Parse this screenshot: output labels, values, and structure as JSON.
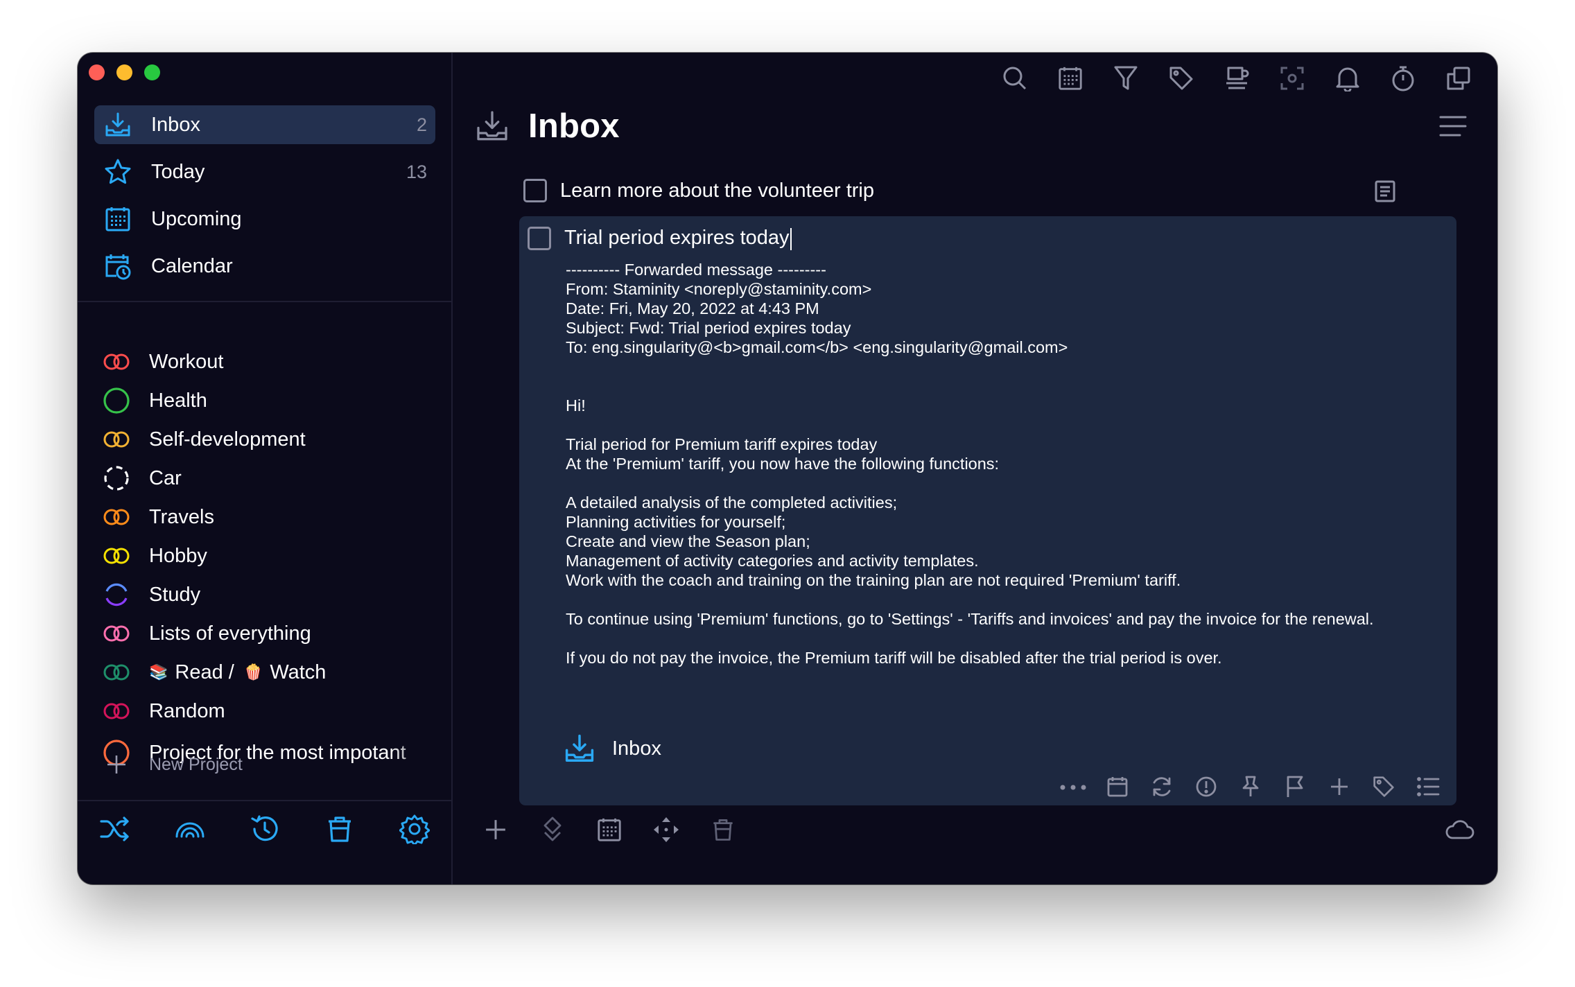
{
  "sidebar": {
    "nav": [
      {
        "label": "Inbox",
        "count": "2",
        "icon": "inbox-tray-icon"
      },
      {
        "label": "Today",
        "count": "13",
        "icon": "star-icon"
      },
      {
        "label": "Upcoming",
        "count": "",
        "icon": "calendar-grid-icon"
      },
      {
        "label": "Calendar",
        "count": "",
        "icon": "calendar-clock-icon"
      }
    ],
    "projects": [
      {
        "label": "Workout",
        "color": "#ff4d4d",
        "icon": "infinity-rings-icon"
      },
      {
        "label": "Health",
        "color": "#36c24a",
        "icon": "ring-icon"
      },
      {
        "label": "Self-development",
        "color": "#f2b233",
        "icon": "infinity-rings-icon"
      },
      {
        "label": "Car",
        "color": "#ffffff",
        "icon": "dashed-ring-icon"
      },
      {
        "label": "Travels",
        "color": "#ff8c1a",
        "icon": "infinity-rings-icon"
      },
      {
        "label": "Hobby",
        "color": "#f5e100",
        "icon": "infinity-rings-icon"
      },
      {
        "label": "Study",
        "color": "#6b5bff",
        "icon": "gradient-ring-icon"
      },
      {
        "label": "Lists of everything",
        "color": "#ff6fae",
        "icon": "infinity-rings-icon"
      },
      {
        "label_a": "Read / ",
        "label_b": "Watch",
        "emoji_a": "📚",
        "emoji_b": "🍿",
        "color": "#1e8f6a",
        "icon": "infinity-rings-icon"
      },
      {
        "label": "Random",
        "color": "#d4145a",
        "icon": "infinity-rings-icon"
      },
      {
        "label": "Project for the most impotant",
        "color": "#ff6a3d",
        "icon": "ring-icon"
      }
    ],
    "new_project": "New Project"
  },
  "main": {
    "title": "Inbox",
    "tasks": [
      {
        "title": "Learn more about the volunteer trip"
      }
    ],
    "expanded_task": {
      "title": "Trial period expires today",
      "body": [
        "---------- Forwarded message ---------",
        "From: Staminity <noreply@staminity.com>",
        "Date: Fri, May 20, 2022 at 4:43 PM",
        "Subject: Fwd: Trial period expires today",
        "To: eng.singularity@<b>gmail.com</b> <eng.singularity@gmail.com>",
        "",
        "",
        "Hi!",
        "",
        "Trial period for Premium tariff expires today",
        "At the 'Premium' tariff, you now have the following functions:",
        "",
        "A detailed analysis of the completed activities;",
        "Planning activities for yourself;",
        "Create and view the Season plan;",
        "Management of activity categories and activity templates.",
        "Work with the coach and training on the training plan are not required 'Premium' tariff.",
        "",
        "To continue using 'Premium' functions, go to 'Settings' - 'Tariffs and invoices' and pay the invoice for the renewal.",
        "",
        "If you do not pay the invoice, the Premium tariff will be disabled after the trial period is over."
      ],
      "project": "Inbox"
    }
  },
  "colors": {
    "accent": "#2aa9f5",
    "window_bg": "#0b0a1b",
    "selected_bg": "#23304f",
    "card_bg": "#1d2840"
  }
}
